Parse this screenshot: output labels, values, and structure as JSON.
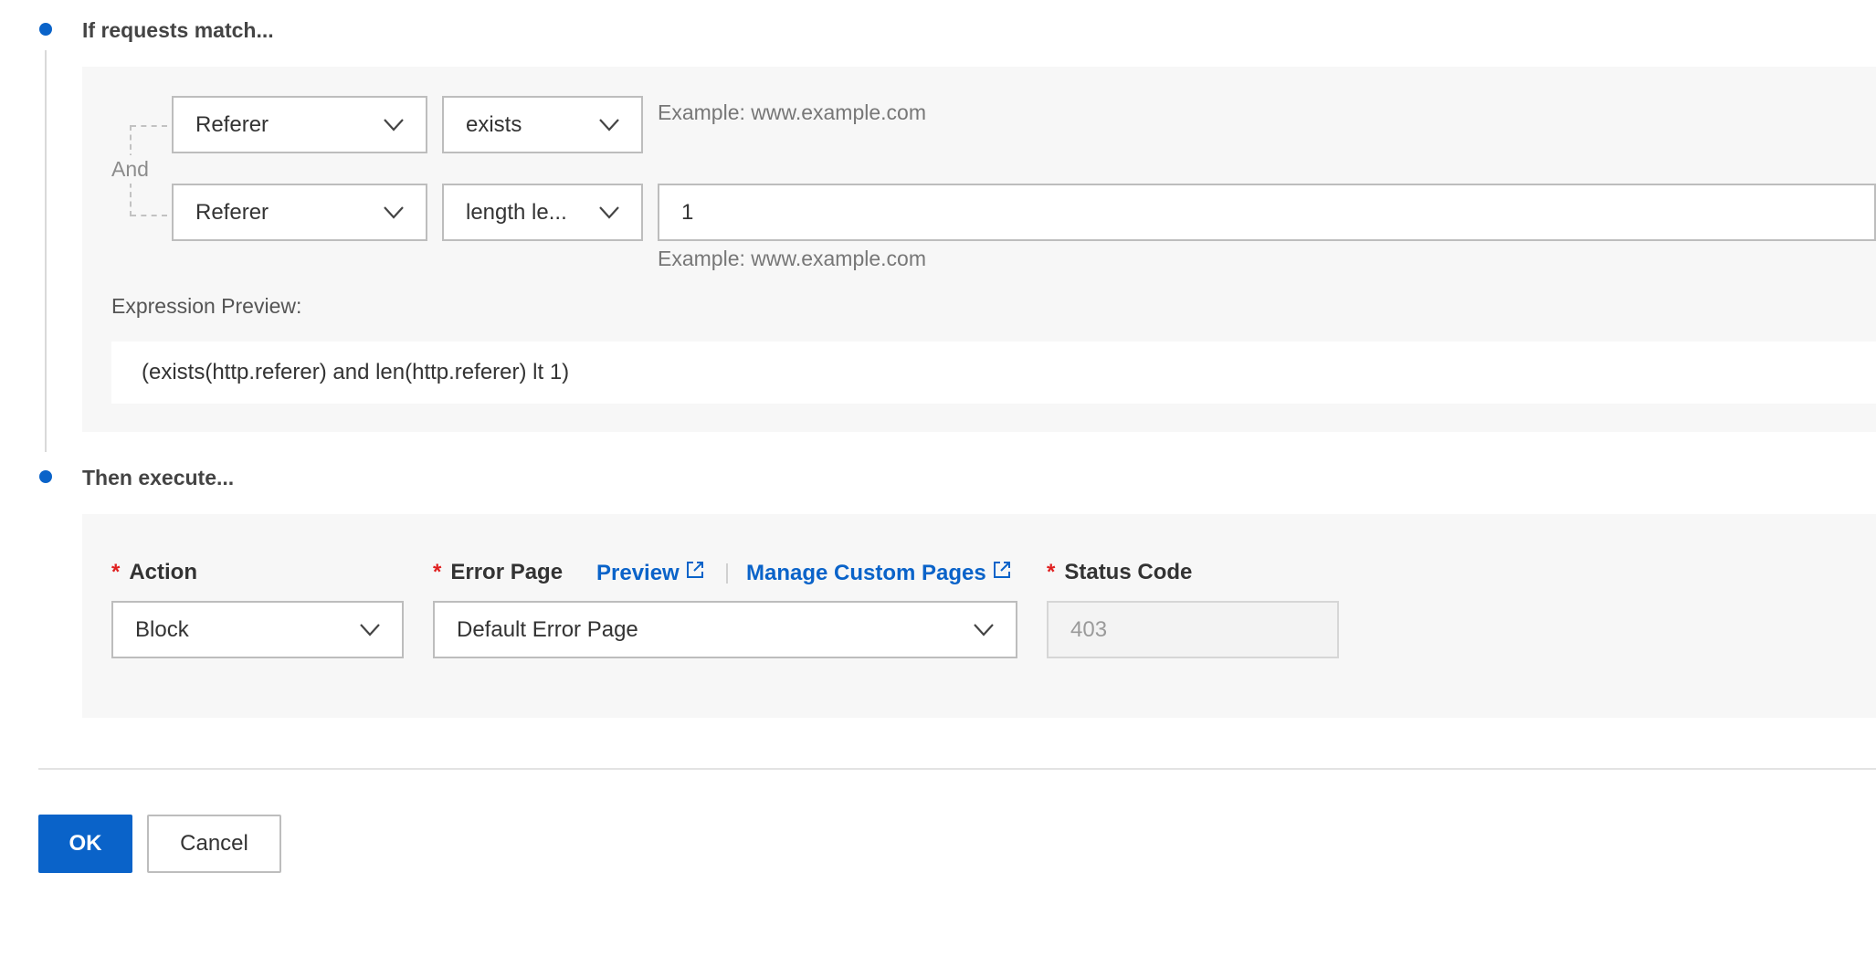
{
  "steps": {
    "match_title": "If requests match...",
    "execute_title": "Then execute..."
  },
  "conditions": {
    "connector": "And",
    "rows": [
      {
        "field": "Referer",
        "operator": "exists",
        "hint": "Example: www.example.com"
      },
      {
        "field": "Referer",
        "operator": "length le...",
        "value": "1",
        "hint": "Example: www.example.com"
      }
    ]
  },
  "preview": {
    "label": "Expression Preview:",
    "expression": "(exists(http.referer) and len(http.referer) lt 1)"
  },
  "execute": {
    "action_label": "Action",
    "action_value": "Block",
    "error_page_label": "Error Page",
    "preview_link": "Preview",
    "manage_link": "Manage Custom Pages",
    "error_page_value": "Default Error Page",
    "status_code_label": "Status Code",
    "status_code_value": "403"
  },
  "footer": {
    "ok": "OK",
    "cancel": "Cancel"
  },
  "colors": {
    "accent": "#0a63c9",
    "required": "#e02020"
  }
}
